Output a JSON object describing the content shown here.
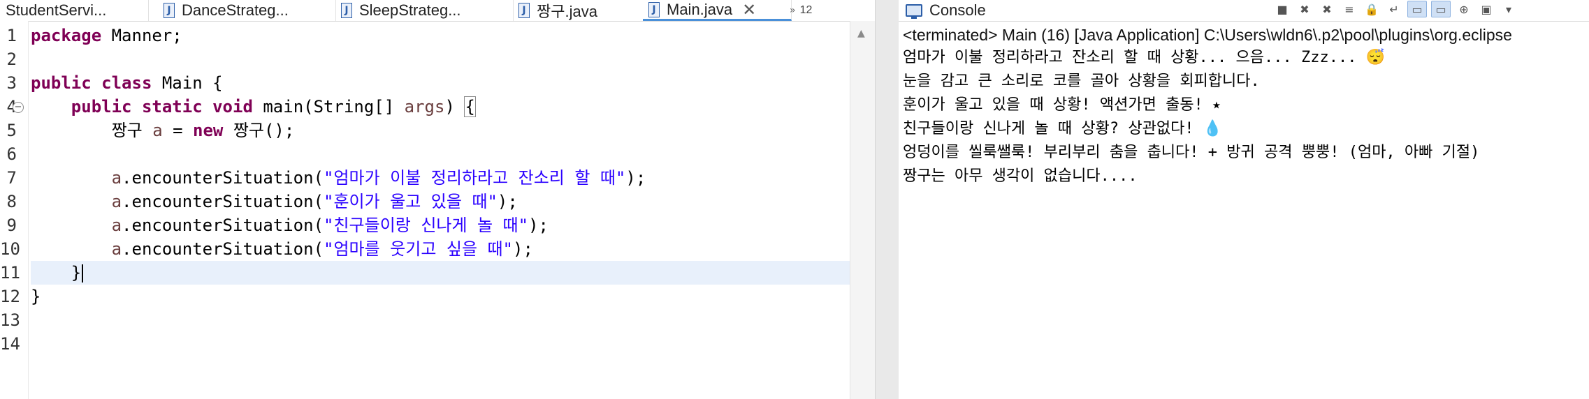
{
  "editor": {
    "tabs": [
      {
        "label": "StudentServi...",
        "icon": "java-file-icon"
      },
      {
        "label": "DanceStrateg...",
        "icon": "java-file-icon"
      },
      {
        "label": "SleepStrateg...",
        "icon": "java-file-icon"
      },
      {
        "label": "짱구.java",
        "icon": "java-file-icon"
      },
      {
        "label": "Main.java",
        "icon": "java-file-icon",
        "active": true
      }
    ],
    "close_glyph": "✕",
    "overflow_count": "12",
    "line_numbers": [
      "1",
      "2",
      "3",
      "4",
      "5",
      "6",
      "7",
      "8",
      "9",
      "10",
      "11",
      "12",
      "13",
      "14"
    ],
    "code": {
      "l1_kw": "package",
      "l1_rest": " Manner;",
      "l3_kw1": "public",
      "l3_kw2": "class",
      "l3_rest": " Main {",
      "l4_indent": "    ",
      "l4_kw1": "public",
      "l4_kw2": "static",
      "l4_kw3": "void",
      "l4_mid": " main(String[] ",
      "l4_var": "args",
      "l4_end": ") ",
      "l4_brace": "{",
      "l5_indent": "        ",
      "l5_type": "짱구 ",
      "l5_var": "a",
      "l5_eq": " = ",
      "l5_kw": "new",
      "l5_rest": " 짱구();",
      "call_indent": "        ",
      "call_var": "a",
      "call_method": ".encounterSituation(",
      "args": [
        "\"엄마가 이불 정리하라고 잔소리 할 때\"",
        "\"훈이가 울고 있을 때\"",
        "\"친구들이랑 신나게 놀 때\"",
        "\"엄마를 웃기고 싶을 때\""
      ],
      "call_end": ");",
      "l11": "    }",
      "l12": "}"
    }
  },
  "console": {
    "tab_label": "Console",
    "header": "<terminated> Main (16) [Java Application] C:\\Users\\wldn6\\.p2\\pool\\plugins\\org.eclipse",
    "lines": [
      "엄마가 이불 정리하라고 잔소리 할 때 상황... 으음... Zzz... 😴",
      "눈을 감고 큰 소리로 코를 골아 상황을 회피합니다.",
      "훈이가 울고 있을 때 상황! 액션가면 출동! ⭑",
      "친구들이랑 신나게 놀 때 상황? 상관없다! 💧",
      "엉덩이를 씰룩쌜룩! 부리부리 춤을 춥니다! + 방귀 공격 뿡뿡! (엄마, 아빠 기절)",
      "짱구는 아무 생각이 없습니다...."
    ]
  }
}
